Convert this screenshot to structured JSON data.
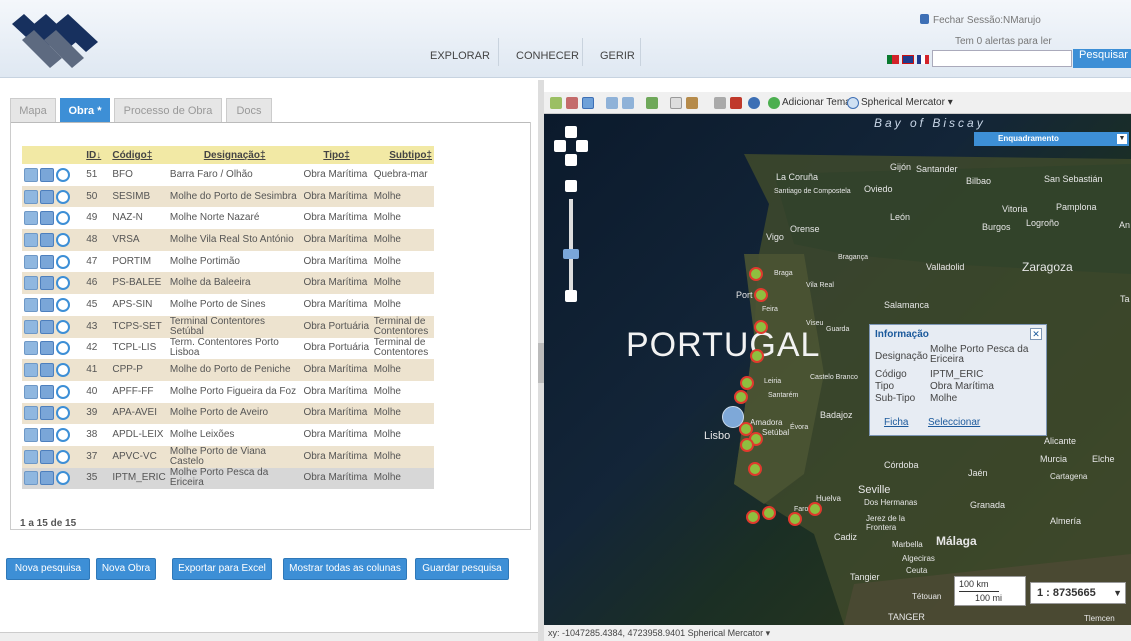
{
  "header": {
    "nav": [
      "EXPLORAR",
      "CONHECER",
      "GERIR"
    ],
    "logout": "Fechar Sessão:NMarujo",
    "alerts": "Tem 0 alertas para ler",
    "search_button": "Pesquisar",
    "search_value": ""
  },
  "tabs": [
    "Mapa",
    "Obra *",
    "Processo de Obra",
    "Docs"
  ],
  "grid": {
    "headers": [
      "ID↓",
      "Código‡",
      "Designação‡",
      "Tipo‡",
      "Subtipo‡"
    ],
    "rows": [
      [
        "51",
        "BFO",
        "Barra Faro / Olhão",
        "Obra Marítima",
        "Quebra-mar"
      ],
      [
        "50",
        "SESIMB",
        "Molhe do Porto de Sesimbra",
        "Obra Marítima",
        "Molhe"
      ],
      [
        "49",
        "NAZ-N",
        "Molhe Norte Nazaré",
        "Obra Marítima",
        "Molhe"
      ],
      [
        "48",
        "VRSA",
        "Molhe Vila Real Sto António",
        "Obra Marítima",
        "Molhe"
      ],
      [
        "47",
        "PORTIM",
        "Molhe Portimão",
        "Obra Marítima",
        "Molhe"
      ],
      [
        "46",
        "PS-BALEE",
        "Molhe da Baleeira",
        "Obra Marítima",
        "Molhe"
      ],
      [
        "45",
        "APS-SIN",
        "Molhe Porto de Sines",
        "Obra Marítima",
        "Molhe"
      ],
      [
        "43",
        "TCPS-SET",
        "Terminal Contentores Setúbal",
        "Obra Portuária",
        "Terminal de Contentores"
      ],
      [
        "42",
        "TCPL-LIS",
        "Term. Contentores Porto Lisboa",
        "Obra Portuária",
        "Terminal de Contentores"
      ],
      [
        "41",
        "CPP-P",
        "Molhe do Porto de Peniche",
        "Obra Marítima",
        "Molhe"
      ],
      [
        "40",
        "APFF-FF",
        "Molhe Porto Figueira da Foz",
        "Obra Marítima",
        "Molhe"
      ],
      [
        "39",
        "APA-AVEI",
        "Molhe Porto de Aveiro",
        "Obra Marítima",
        "Molhe"
      ],
      [
        "38",
        "APDL-LEIX",
        "Molhe Leixões",
        "Obra Marítima",
        "Molhe"
      ],
      [
        "37",
        "APVC-VC",
        "Molhe Porto de Viana Castelo",
        "Obra Marítima",
        "Molhe"
      ],
      [
        "35",
        "IPTM_ERIC",
        "Molhe Porto Pesca da Ericeira",
        "Obra Marítima",
        "Molhe"
      ]
    ]
  },
  "pagination": "1 a 15 de 15",
  "buttons": [
    "Nova pesquisa",
    "Nova Obra",
    "Exportar para Excel",
    "Mostrar todas as colunas",
    "Guardar pesquisa"
  ],
  "map": {
    "toolbar": {
      "add_theme": "Adicionar Tema",
      "projection": "Spherical Mercator ▾"
    },
    "enquadramento": "Enquadramento",
    "labels": {
      "portugal": "PORTUGAL",
      "bay": "Bay of Biscay",
      "lisboa": "Lisbo",
      "porto": "Port",
      "coruna": "La Coruña",
      "santiago": "Santiago de Compostela",
      "gijon": "Gijón",
      "santander": "Santander",
      "oviedo": "Oviedo",
      "bilbao": "Bilbao",
      "sansebastian": "San Sebastián",
      "vitoria": "Vitoria",
      "pamplona": "Pamplona",
      "leon": "León",
      "burgos": "Burgos",
      "logrono": "Logroño",
      "vigo": "Vigo",
      "orense": "Orense",
      "braga": "Braga",
      "vilareal": "Vila Real",
      "braganca": "Bragança",
      "valladolid": "Valladolid",
      "zaragoza": "Zaragoza",
      "salamanca": "Salamanca",
      "feira": "Feira",
      "viseu": "Viseu",
      "guarda": "Guarda",
      "leiria": "Leiria",
      "castelobranco": "Castelo Branco",
      "santarem": "Santarém",
      "badajoz": "Badajoz",
      "amadora": "Amadora",
      "setubal": "Setúbal",
      "evora": "Évora",
      "cordoba": "Córdoba",
      "jaen": "Jaén",
      "murcia": "Murcia",
      "elche": "Elche",
      "alicante": "Alicante",
      "cartagena": "Cartagena",
      "seville": "Seville",
      "doshermanas": "Dos Hermanas",
      "granada": "Granada",
      "almeria": "Almería",
      "huelva": "Huelva",
      "jerez": "Jerez de la Frontera",
      "cadiz": "Cadiz",
      "marbella": "Marbella",
      "malaga": "Málaga",
      "algeciras": "Algeciras",
      "ceuta": "Ceuta",
      "tangier": "Tangier",
      "tetouan": "Tétouan",
      "tanger": "TANGER",
      "tlemcen": "Tlemcen",
      "faro": "Faro",
      "ta": "Ta",
      "an": "An"
    },
    "info": {
      "title": "Informação",
      "designacao_label": "Designação",
      "designacao": "Molhe Porto Pesca da Ericeira",
      "codigo_label": "Código",
      "codigo": "IPTM_ERIC",
      "tipo_label": "Tipo",
      "tipo": "Obra Marítima",
      "subtipo_label": "Sub-Tipo",
      "subtipo": "Molhe",
      "ficha": "Ficha",
      "seleccionar": "Seleccionar"
    },
    "scale_km": "100 km",
    "scale_mi": "100 mi",
    "scale_ratio": "1 : 8735665",
    "status": "xy: -1047285.4384, 4723958.9401  Spherical Mercator ▾"
  },
  "colors": {
    "accent": "#3d8fd6",
    "header_row": "#f2e9a5",
    "even_row": "#ede3cf",
    "marker_border": "#e03a2d"
  }
}
